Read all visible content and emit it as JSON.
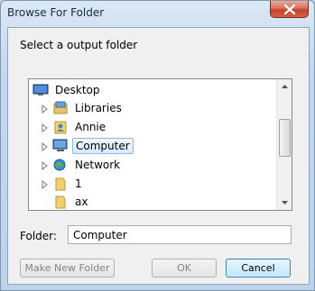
{
  "window": {
    "title": "Browse For Folder"
  },
  "dialog": {
    "prompt": "Select a output folder"
  },
  "tree": {
    "items": [
      {
        "label": "Desktop",
        "icon": "desktop-icon",
        "has_children": false,
        "selected": false
      },
      {
        "label": "Libraries",
        "icon": "library-icon",
        "has_children": true,
        "selected": false
      },
      {
        "label": "Annie",
        "icon": "user-folder-icon",
        "has_children": true,
        "selected": false
      },
      {
        "label": "Computer",
        "icon": "computer-icon",
        "has_children": true,
        "selected": true
      },
      {
        "label": "Network",
        "icon": "network-icon",
        "has_children": true,
        "selected": false
      },
      {
        "label": "1",
        "icon": "folder-icon",
        "has_children": true,
        "selected": false
      },
      {
        "label": "ax",
        "icon": "folder-icon",
        "has_children": false,
        "selected": false
      }
    ]
  },
  "folder": {
    "label": "Folder:",
    "value": "Computer"
  },
  "buttons": {
    "new_folder": "Make New Folder",
    "ok": "OK",
    "cancel": "Cancel"
  },
  "colors": {
    "accent": "#3c7fb1",
    "close": "#c5442b",
    "selection": "#d8ebfc"
  }
}
